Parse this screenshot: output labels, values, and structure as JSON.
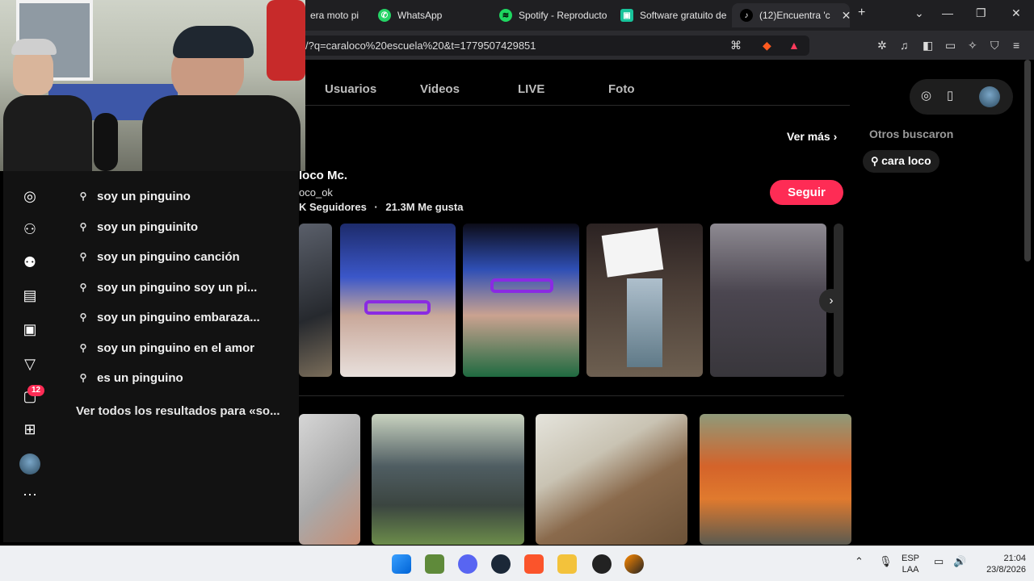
{
  "browser": {
    "tabs": [
      {
        "label": "era moto pi",
        "icon": "tab-icon"
      },
      {
        "label": "WhatsApp",
        "icon": "whatsapp-icon"
      },
      {
        "label": "Spotify - Reproducto",
        "icon": "spotify-icon"
      },
      {
        "label": "Software gratuito de",
        "icon": "app-icon"
      },
      {
        "label": "(12)Encuentra 'c",
        "icon": "tiktok-icon"
      }
    ],
    "new_tab": "+",
    "url": "/?q=caraloco%20escuela%20&t=1779507429851"
  },
  "nav": {
    "tabs": [
      "Usuarios",
      "Videos",
      "LIVE",
      "Foto"
    ]
  },
  "user": {
    "name": "loco Mc.",
    "handle": "oco_ok",
    "followers": "K Seguidores",
    "separator": "·",
    "likes": "21.3M Me gusta",
    "follow_button": "Seguir"
  },
  "ver_mas": "Ver más",
  "others_searched": {
    "title": "Otros buscaron",
    "items": [
      "cara loco"
    ]
  },
  "search_suggestions": [
    "soy un pinguino",
    "soy un pinguinito",
    "soy un pinguino canción",
    "soy un pinguino soy un pi...",
    "soy un pinguino embaraza...",
    "soy un pinguino en el amor",
    "es un pinguino"
  ],
  "see_all": "Ver todos los resultados para «so...",
  "sidebar": {
    "badge": "12",
    "icons": [
      "compass-icon",
      "person-add-icon",
      "people-icon",
      "film-icon",
      "tv-icon",
      "send-icon",
      "inbox-icon",
      "add-icon",
      "profile-avatar",
      "more-icon"
    ]
  },
  "taskbar": {
    "lang_top": "ESP",
    "lang_bottom": "LAA",
    "time": "21:04",
    "date": "23/8/2026"
  },
  "colors": {
    "accent": "#fe2c55",
    "background": "#000000",
    "sidebar": "#121212"
  }
}
